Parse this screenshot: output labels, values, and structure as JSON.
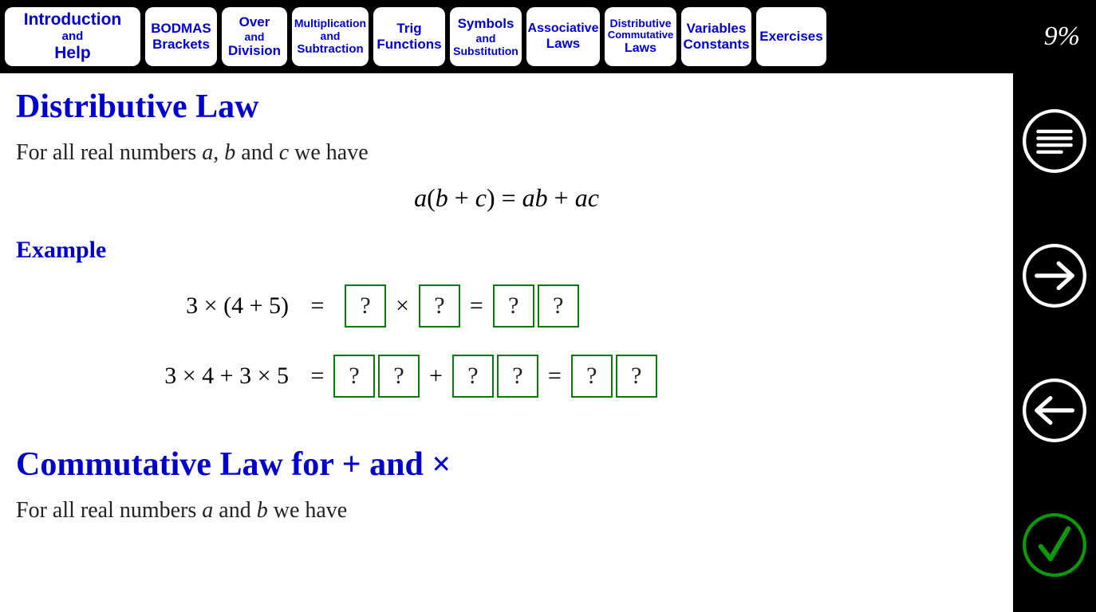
{
  "progress": "9%",
  "tabs": [
    {
      "l1": "Introduction",
      "l2": "and",
      "l3": "Help"
    },
    {
      "l1": "BODMAS",
      "l2": "",
      "l3": "Brackets"
    },
    {
      "l1": "Over",
      "l2": "and",
      "l3": "Division"
    },
    {
      "l1": "Multiplication",
      "l2": "and",
      "l3": "Subtraction"
    },
    {
      "l1": "Trig",
      "l2": "",
      "l3": "Functions"
    },
    {
      "l1": "Symbols",
      "l2": "and",
      "l3": "Substitution"
    },
    {
      "l1": "Associative",
      "l2": "",
      "l3": "Laws"
    },
    {
      "l1": "Distributive",
      "l2": "Commutative",
      "l3": "Laws"
    },
    {
      "l1": "Variables",
      "l2": "",
      "l3": "Constants"
    },
    {
      "l1": "Exercises",
      "l2": "",
      "l3": ""
    }
  ],
  "section1": {
    "title": "Distributive Law",
    "intro_pre": "For all real numbers ",
    "intro_a": "a",
    "intro_sep1": ", ",
    "intro_b": "b",
    "intro_sep2": " and ",
    "intro_c": "c",
    "intro_post": " we have",
    "formula": "a(b + c) = ab + ac",
    "example_label": "Example",
    "row1_lhs": "3 × (4 + 5)",
    "row2_lhs": "3 × 4 + 3 × 5",
    "eq": "=",
    "times": "×",
    "plus": "+",
    "q": "?"
  },
  "section2": {
    "title_pre": "Commutative Law for ",
    "title_plus": "+",
    "title_and": " and ",
    "title_times": "×",
    "intro_pre": "For all real numbers ",
    "intro_a": "a",
    "intro_and": " and ",
    "intro_b": "b",
    "intro_post": " we have"
  }
}
